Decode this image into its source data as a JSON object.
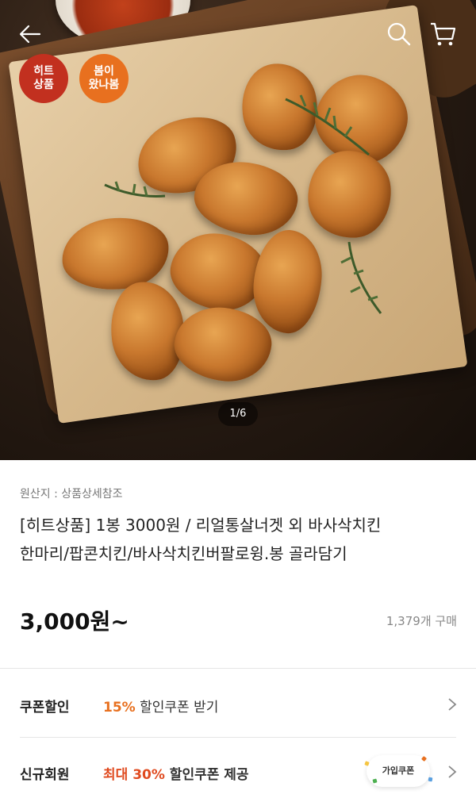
{
  "top_bar": {
    "back_icon": "arrow-left-icon",
    "search_icon": "search-icon",
    "cart_icon": "cart-icon"
  },
  "badges": [
    {
      "line1": "히트",
      "line2": "상품",
      "color": "#c2301f"
    },
    {
      "line1": "봄이",
      "line2": "왔나봄",
      "color": "#e8701f"
    }
  ],
  "gallery": {
    "page_indicator": "1/6"
  },
  "product": {
    "origin": "원산지 : 상품상세참조",
    "title_line1": "[히트상품] 1봉 3000원 / 리얼통살너겟 외 바사삭치킨",
    "title_line2": "한마리/팝콘치킨/바사삭치킨버팔로윙.봉 골라담기",
    "price": "3,000원~",
    "sold_count": "1,379개 구매"
  },
  "coupon_row": {
    "label": "쿠폰할인",
    "highlight": "15%",
    "text": " 할인쿠폰 받기"
  },
  "member_row": {
    "label": "신규회원",
    "highlight": "최대 30%",
    "text": " 할인쿠폰 제공",
    "badge": "가입쿠폰"
  },
  "colors": {
    "accent_orange": "#e8701f",
    "accent_red": "#e04a1f"
  }
}
